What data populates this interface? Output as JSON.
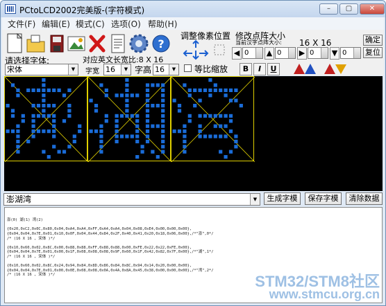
{
  "window": {
    "title": "PCtoLCD2002完美版-(字符模式)",
    "controls": [
      "–",
      "▢",
      "✕"
    ]
  },
  "menu": [
    "文件(F)",
    "编辑(E)",
    "模式(C)",
    "选项(O)",
    "帮助(H)"
  ],
  "toolbar": {
    "font_label": "请选择字体:",
    "font_value": "宋体",
    "ascii_label": "对应英文长宽比:",
    "ascii_size": "8 X 16",
    "width_label": "字宽",
    "width_value": "16",
    "height_label": "字高",
    "height_value": "16",
    "proportional_label": "等比缩放",
    "bold": "B",
    "italic": "I",
    "underline": "U",
    "adjust_label": "调整像素位置",
    "dot_size_label": "修改点阵大小",
    "current_dot_label": "当前汉字点阵大小:",
    "current_dot_value": "16 X 16",
    "confirm": "确定",
    "restore": "复位",
    "spins": [
      "0",
      "0",
      "0",
      "0"
    ]
  },
  "input": {
    "text": "澎湖湾"
  },
  "buttons": {
    "generate": "生成字模",
    "save": "保存字模",
    "clear": "清除数据"
  },
  "output_lines": [
    "澎(0) 湖(1) 湾(2)",
    "",
    "{0x20,0xC2,0x0C,0x80,0x04,0xA4,0xA4,0xFF,0xA4,0xA4,0x04,0x08,0xE4,0x00,0x00,0x00},",
    "{0x04,0x04,0x7E,0x01,0x10,0x0F,0x04,0x44,0x84,0x2F,0x40,0x41,0x20,0x18,0x06,0x00},/*\"澎\",0*/",
    "/* (16 X 16 , 宋体 )*/",
    "",
    "{0x10,0x60,0x02,0x8C,0x00,0x88,0x88,0xFF,0x88,0x88,0x00,0xFE,0x22,0x22,0xFE,0x00},",
    "{0x04,0x04,0x7E,0x01,0x00,0x1F,0x08,0x08,0x08,0x9F,0x60,0x1F,0x42,0x82,0x7F,0x00},/*\"湖\",1*/",
    "/* (16 X 16 , 宋体 )*/",
    "",
    "{0x10,0x60,0x02,0x8C,0x24,0x94,0x84,0x8D,0x86,0x84,0x8C,0x94,0x14,0x20,0x00,0x00},",
    "{0x04,0x04,0x7E,0x01,0x00,0x0E,0x08,0x08,0x0A,0x4A,0x8A,0x45,0x38,0x00,0x00,0x00},/*\"湾\",2*/",
    "/* (16 X 16 , 宋体 )*/"
  ],
  "watermark": {
    "line1": "STM32/STM8社区",
    "line2": "www.stmcu.org.cn"
  },
  "bitmap_color": "#1a6cd8",
  "frame_color": "#e0d000"
}
